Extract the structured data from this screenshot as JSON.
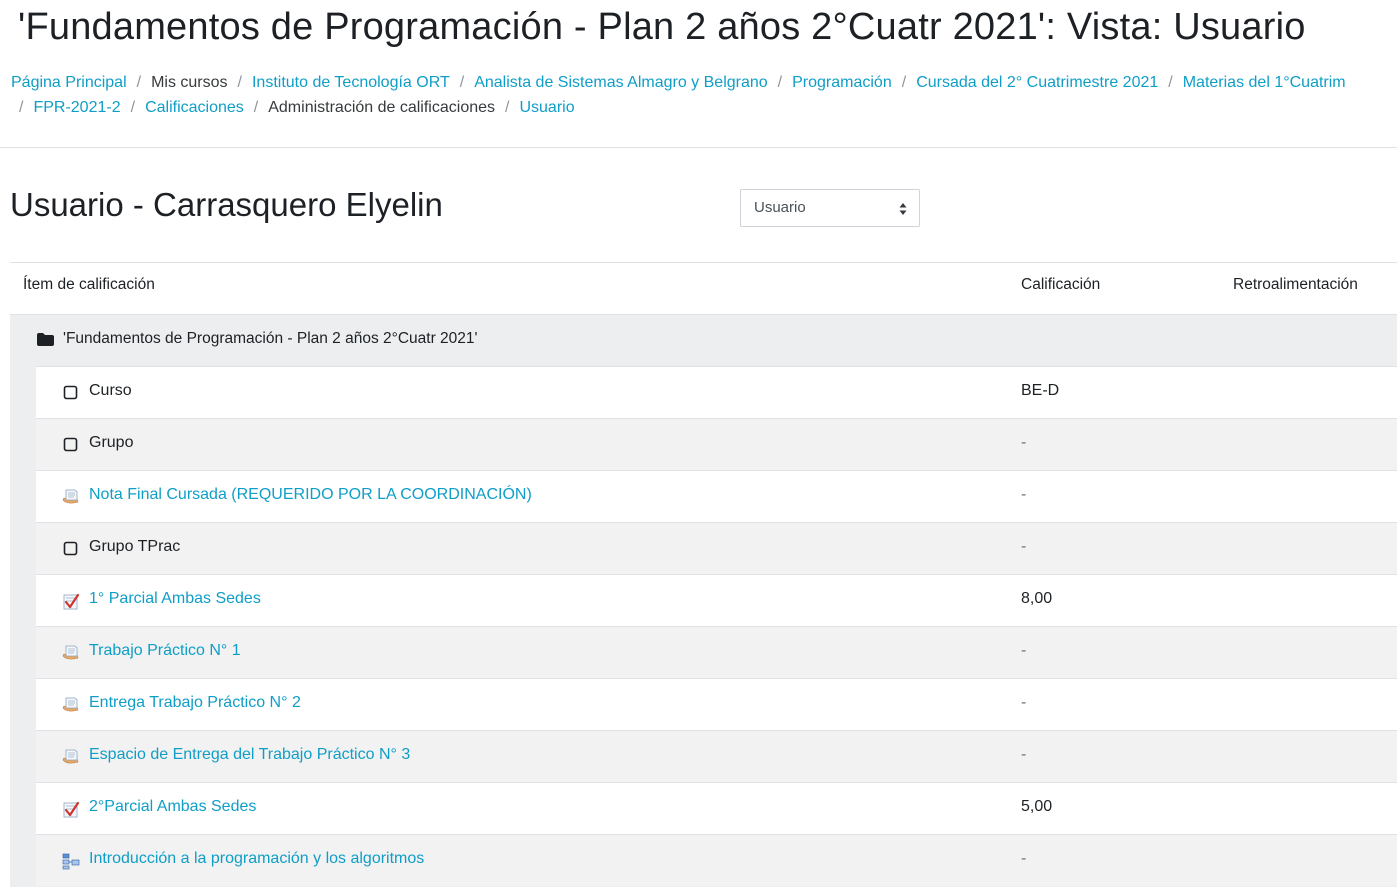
{
  "page_title": "'Fundamentos de Programación - Plan 2 años 2°Cuatr 2021': Vista: Usuario",
  "breadcrumb": {
    "line1": [
      {
        "label": "Página Principal",
        "link": true
      },
      {
        "label": "Mis cursos",
        "link": false
      },
      {
        "label": "Instituto de Tecnología ORT",
        "link": true
      },
      {
        "label": "Analista de Sistemas Almagro y Belgrano",
        "link": true
      },
      {
        "label": "Programación",
        "link": true
      },
      {
        "label": "Cursada del 2° Cuatrimestre 2021",
        "link": true
      },
      {
        "label": "Materias del 1°Cuatrim",
        "link": true
      }
    ],
    "line2": [
      {
        "label": "FPR-2021-2",
        "link": true
      },
      {
        "label": "Calificaciones",
        "link": true
      },
      {
        "label": "Administración de calificaciones",
        "link": false
      },
      {
        "label": "Usuario",
        "link": true
      }
    ],
    "separator": "/"
  },
  "user_heading": "Usuario - Carrasquero Elyelin",
  "view_select": {
    "value": "Usuario"
  },
  "table": {
    "headers": {
      "item": "Ítem de calificación",
      "grade": "Calificación",
      "feedback": "Retroalimentación"
    },
    "category": {
      "label": "'Fundamentos de Programación - Plan 2 años 2°Cuatr 2021'",
      "icon": "folder-icon"
    },
    "rows": [
      {
        "label": "Curso",
        "grade": "BE-D",
        "icon": "checkbox-square-icon",
        "link": false
      },
      {
        "label": "Grupo",
        "grade": "-",
        "icon": "checkbox-square-icon",
        "link": false
      },
      {
        "label": "Nota Final Cursada (REQUERIDO POR LA COORDINACIÓN)",
        "grade": "-",
        "icon": "assignment-icon",
        "link": true
      },
      {
        "label": "Grupo TPrac",
        "grade": "-",
        "icon": "checkbox-square-icon",
        "link": false
      },
      {
        "label": "1° Parcial Ambas Sedes",
        "grade": "8,00",
        "icon": "quiz-icon",
        "link": true
      },
      {
        "label": "Trabajo Práctico N° 1",
        "grade": "-",
        "icon": "assignment-icon",
        "link": true
      },
      {
        "label": "Entrega Trabajo Práctico N° 2",
        "grade": "-",
        "icon": "assignment-icon",
        "link": true
      },
      {
        "label": "Espacio de Entrega del Trabajo Práctico N° 3",
        "grade": "-",
        "icon": "assignment-icon",
        "link": true
      },
      {
        "label": "2°Parcial Ambas Sedes",
        "grade": "5,00",
        "icon": "quiz-icon",
        "link": true
      },
      {
        "label": "Introducción a la programación y los algoritmos",
        "grade": "-",
        "icon": "lesson-icon",
        "link": true
      }
    ]
  },
  "colors": {
    "link": "#0f9ec7",
    "text": "#1d2125",
    "category_bg": "#eceeef",
    "row_alt_bg": "#f2f2f2"
  }
}
